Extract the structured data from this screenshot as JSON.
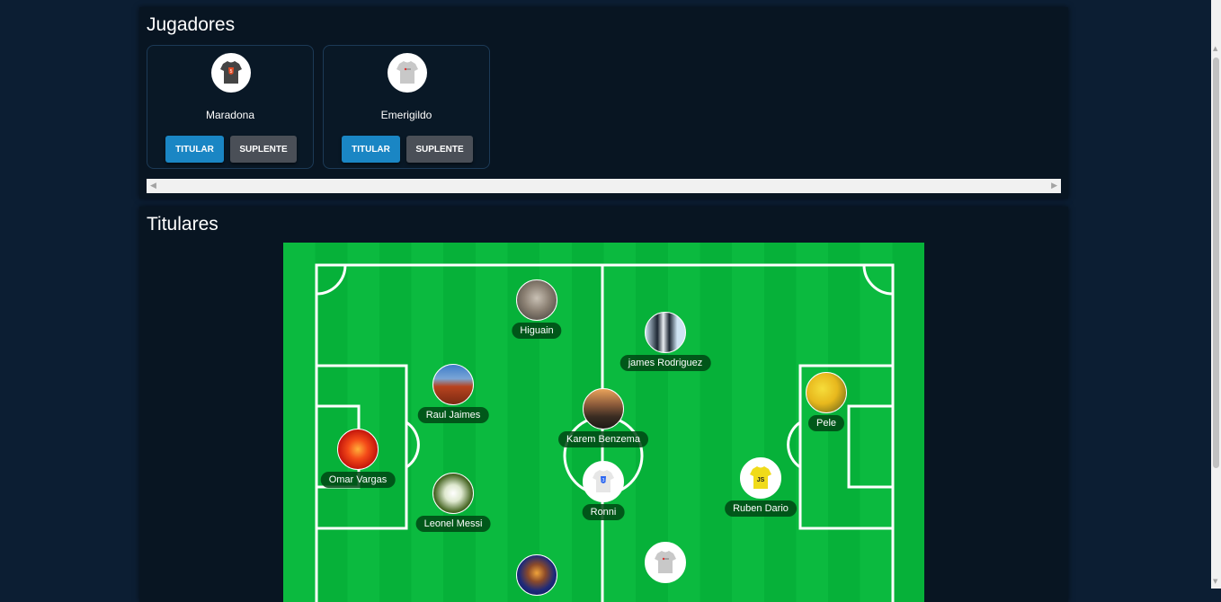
{
  "jugadores": {
    "title": "Jugadores",
    "players": [
      {
        "name": "Maradona",
        "titular_label": "TITULAR",
        "suplente_label": "SUPLENTE",
        "avatar_icon": "html5-tshirt-icon"
      },
      {
        "name": "Emerigildo",
        "titular_label": "TITULAR",
        "suplente_label": "SUPLENTE",
        "avatar_icon": "grey-tshirt-icon"
      }
    ]
  },
  "titulares": {
    "title": "Titulares",
    "players": [
      {
        "name": "Higuain",
        "avatar_icon": "koala-photo"
      },
      {
        "name": "james Rodriguez",
        "avatar_icon": "penguins-photo"
      },
      {
        "name": "Raul Jaimes",
        "avatar_icon": "desert-photo"
      },
      {
        "name": "Karem Benzema",
        "avatar_icon": "lighthouse-photo"
      },
      {
        "name": "Pele",
        "avatar_icon": "tulips-photo"
      },
      {
        "name": "Omar Vargas",
        "avatar_icon": "chrysanthemum-photo"
      },
      {
        "name": "Ronni",
        "avatar_icon": "css3-tshirt-icon"
      },
      {
        "name": "Ruben Dario",
        "avatar_icon": "js-tshirt-icon"
      },
      {
        "name": "Leonel Messi",
        "avatar_icon": "hydrangea-photo"
      }
    ]
  },
  "colors": {
    "page_background": "#0c1e33",
    "panel_background": "#081522",
    "titular_button": "#1a86c4",
    "suplente_button": "#4a4f57",
    "field_green": "#0bba3f"
  }
}
